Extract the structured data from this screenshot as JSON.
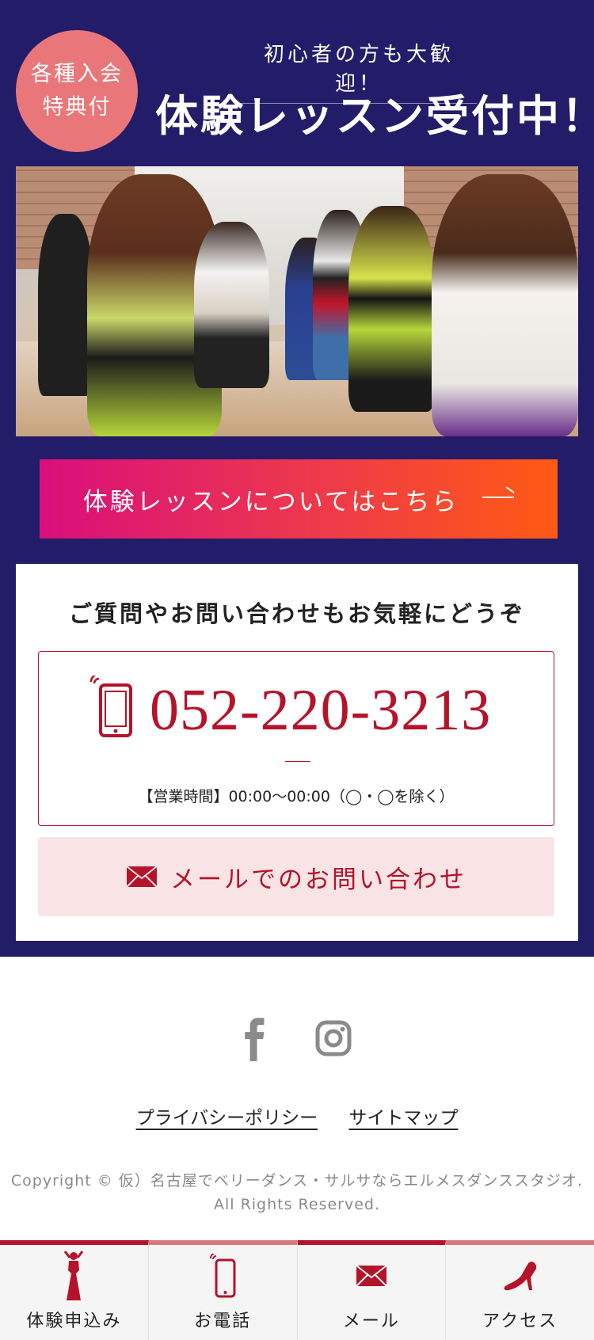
{
  "colors": {
    "navy": "#231c68",
    "badge": "#e9777a",
    "brand_red": "#b5132a",
    "cta_start": "#d90f7c",
    "cta_end": "#ff5a12",
    "mail_bg": "#f8e4e5"
  },
  "hero": {
    "badge_line1": "各種入会",
    "badge_line2": "特典付",
    "subtitle": "初心者の方も大歓迎！",
    "title": "体験レッスン受付中！"
  },
  "cta": {
    "label": "体験レッスンについてはこちら",
    "icon": "arrow-right-icon"
  },
  "contact": {
    "heading": "ご質問やお問い合わせもお気軽にどうぞ",
    "phone_number": "052-220-3213",
    "phone_icon": "smartphone-icon",
    "hours": "【営業時間】00:00〜00:00（◯・◯を除く）",
    "mail_label": "メールでのお問い合わせ",
    "mail_icon": "envelope-icon"
  },
  "footer": {
    "social": [
      "facebook-icon",
      "instagram-icon"
    ],
    "links": [
      "プライバシーポリシー",
      "サイトマップ"
    ],
    "copyright_line1": "Copyright © 仮）名古屋でベリーダンス・サルサならエルメスダンススタジオ.",
    "copyright_line2": "All Rights Reserved."
  },
  "bottom_nav": [
    {
      "label": "体験申込み",
      "icon": "dancer-icon"
    },
    {
      "label": "お電話",
      "icon": "smartphone-icon"
    },
    {
      "label": "メール",
      "icon": "envelope-icon"
    },
    {
      "label": "アクセス",
      "icon": "high-heel-icon"
    }
  ]
}
